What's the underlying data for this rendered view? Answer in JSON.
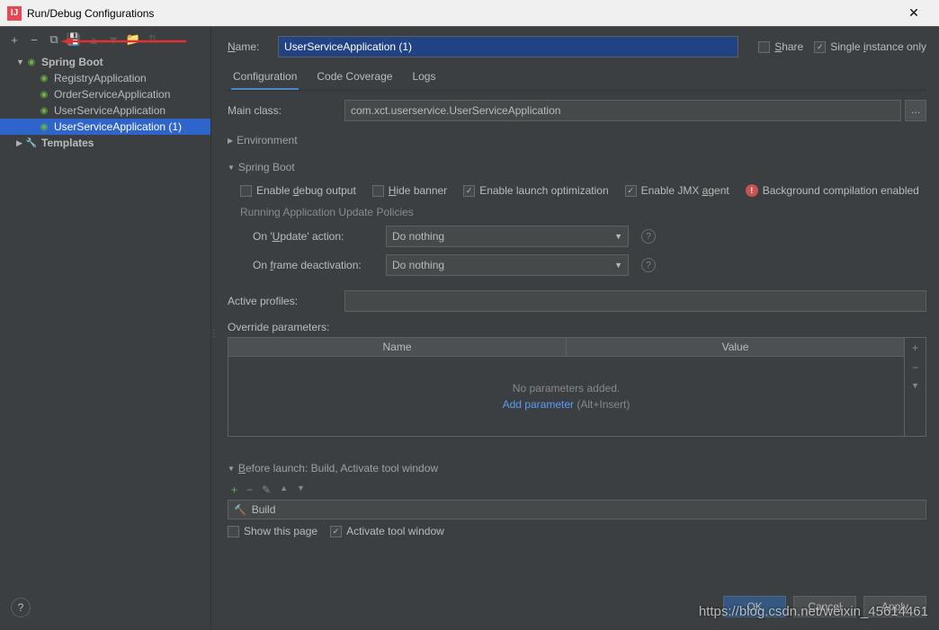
{
  "window": {
    "title": "Run/Debug Configurations"
  },
  "tree": {
    "root": "Spring Boot",
    "items": [
      "RegistryApplication",
      "OrderServiceApplication",
      "UserServiceApplication",
      "UserServiceApplication (1)"
    ],
    "templates": "Templates"
  },
  "name": {
    "label": "Name:",
    "value": "UserServiceApplication (1)"
  },
  "share": {
    "share_label": "Share",
    "single_instance_label": "Single instance only"
  },
  "tabs": {
    "configuration": "Configuration",
    "code_coverage": "Code Coverage",
    "logs": "Logs"
  },
  "main_class": {
    "label": "Main class:",
    "value": "com.xct.userservice.UserServiceApplication"
  },
  "environment": {
    "label": "Environment"
  },
  "spring_boot": {
    "header": "Spring Boot",
    "enable_debug": "Enable debug output",
    "hide_banner": "Hide banner",
    "enable_launch_opt": "Enable launch optimization",
    "enable_jmx": "Enable JMX agent",
    "bg_compilation": "Background compilation enabled",
    "policies_title": "Running Application Update Policies",
    "on_update_label": "On 'Update' action:",
    "on_update_value": "Do nothing",
    "on_frame_label": "On frame deactivation:",
    "on_frame_value": "Do nothing"
  },
  "active_profiles": {
    "label": "Active profiles:"
  },
  "override": {
    "label": "Override parameters:",
    "col_name": "Name",
    "col_value": "Value",
    "empty_msg": "No parameters added.",
    "add_link": "Add parameter",
    "add_hint": "(Alt+Insert)"
  },
  "before_launch": {
    "header": "Before launch: Build, Activate tool window",
    "build_item": "Build",
    "show_page": "Show this page",
    "activate_tw": "Activate tool window"
  },
  "buttons": {
    "ok": "OK",
    "cancel": "Cancel",
    "apply": "Apply"
  },
  "watermark": "https://blog.csdn.net/weixin_45614461"
}
